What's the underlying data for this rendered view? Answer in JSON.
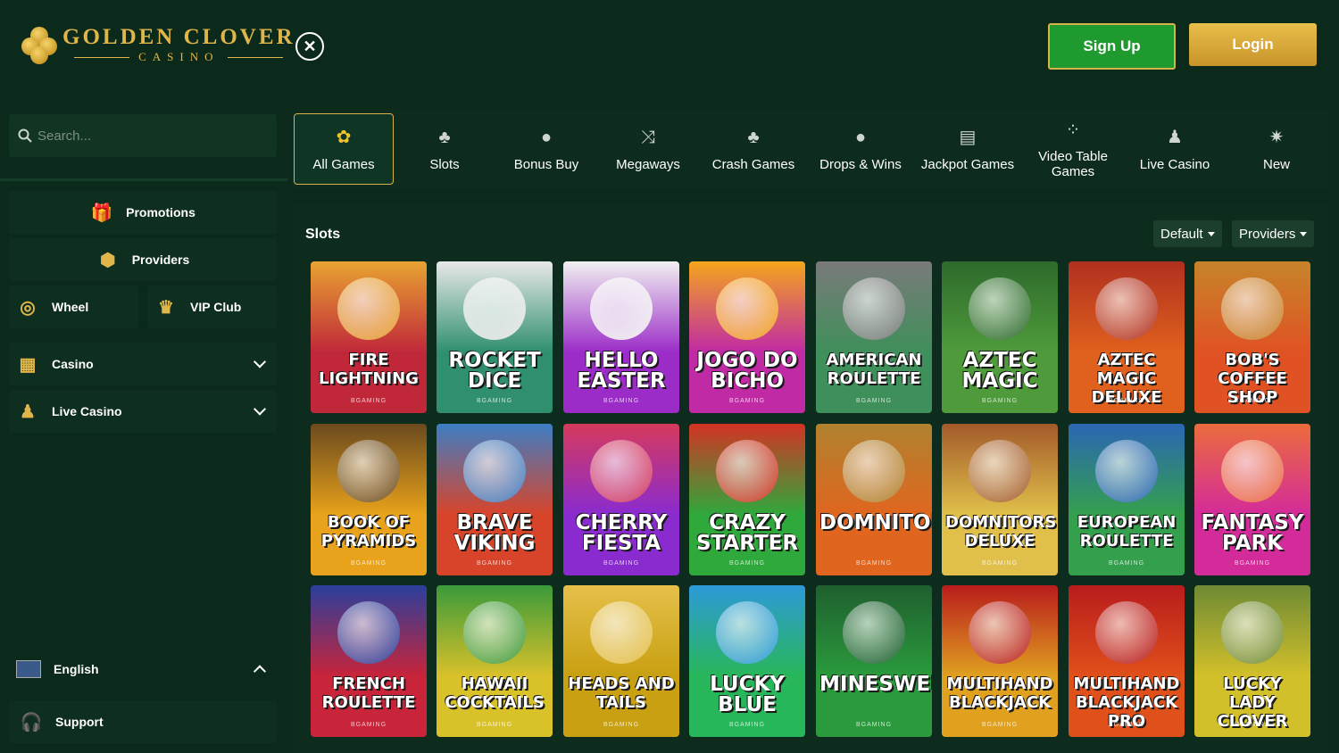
{
  "brand": {
    "name": "GOLDEN CLOVER",
    "sub": "CASINO"
  },
  "header": {
    "signup": "Sign Up",
    "login": "Login"
  },
  "sidebar": {
    "search_placeholder": "Search...",
    "promotions": "Promotions",
    "providers": "Providers",
    "wheel": "Wheel",
    "vip": "VIP Club",
    "casino": "Casino",
    "live_casino": "Live Casino",
    "language": "English",
    "support": "Support"
  },
  "tabs": [
    {
      "label": "All Games",
      "icon": "clover-icon"
    },
    {
      "label": "Slots",
      "icon": "cherries-icon"
    },
    {
      "label": "Bonus Buy",
      "icon": "money-bag-icon"
    },
    {
      "label": "Megaways",
      "icon": "shuffle-icon"
    },
    {
      "label": "Crash Games",
      "icon": "cherries-icon"
    },
    {
      "label": "Drops & Wins",
      "icon": "money-bag-icon"
    },
    {
      "label": "Jackpot Games",
      "icon": "slot-machine-icon"
    },
    {
      "label": "Video Table Games",
      "icon": "dice-icon"
    },
    {
      "label": "Live Casino",
      "icon": "dealer-icon"
    },
    {
      "label": "New",
      "icon": "sparkle-icon"
    }
  ],
  "section": {
    "title": "Slots",
    "sort": "Default",
    "filter": "Providers"
  },
  "provider_label": "BGAMING",
  "games": [
    {
      "title": "FIRE LIGHTNING",
      "bg": "#c0283a",
      "accent": "#e8a331"
    },
    {
      "title": "ROCKET DICE",
      "bg": "#2f8f6e",
      "accent": "#e8e8e8"
    },
    {
      "title": "HELLO EASTER",
      "bg": "#9b2cc8",
      "accent": "#f1f1f1"
    },
    {
      "title": "JOGO DO BICHO",
      "bg": "#c02aa4",
      "accent": "#f4a51c"
    },
    {
      "title": "AMERICAN ROULETTE",
      "bg": "#3f8f5a",
      "accent": "#7a7a7a"
    },
    {
      "title": "AZTEC MAGIC",
      "bg": "#4f9b3b",
      "accent": "#2d6a2c"
    },
    {
      "title": "AZTEC MAGIC DELUXE",
      "bg": "#e0601d",
      "accent": "#b03020"
    },
    {
      "title": "BOB'S COFFEE SHOP",
      "bg": "#e05223",
      "accent": "#c7842a"
    },
    {
      "title": "BOOK OF PYRAMIDS",
      "bg": "#e8a21b",
      "accent": "#6b4a1e"
    },
    {
      "title": "BRAVE VIKING",
      "bg": "#d8442a",
      "accent": "#3d7ec4"
    },
    {
      "title": "CHERRY FIESTA",
      "bg": "#8a2bd0",
      "accent": "#d63a5c"
    },
    {
      "title": "CRAZY STARTER",
      "bg": "#2fa83c",
      "accent": "#d33323"
    },
    {
      "title": "DOMNITORS",
      "bg": "#e0661f",
      "accent": "#b0822f"
    },
    {
      "title": "DOMNITORS DELUXE",
      "bg": "#e0c04a",
      "accent": "#a35a2a"
    },
    {
      "title": "EUROPEAN ROULETTE",
      "bg": "#34a04d",
      "accent": "#2b66b4"
    },
    {
      "title": "FANTASY PARK",
      "bg": "#d42b9a",
      "accent": "#eb6c3c"
    },
    {
      "title": "FRENCH ROULETTE",
      "bg": "#c8243a",
      "accent": "#2a3f9c"
    },
    {
      "title": "HAWAII COCKTAILS",
      "bg": "#d9c12a",
      "accent": "#3a9a3a"
    },
    {
      "title": "HEADS AND TAILS",
      "bg": "#c8a012",
      "accent": "#e5c04a"
    },
    {
      "title": "LUCKY BLUE",
      "bg": "#28b65a",
      "accent": "#2d9ad8"
    },
    {
      "title": "MINESWEEPER",
      "bg": "#2a9a3c",
      "accent": "#1f5f2f"
    },
    {
      "title": "MULTIHAND BLACKJACK",
      "bg": "#e0a020",
      "accent": "#b81c1c"
    },
    {
      "title": "MULTIHAND BLACKJACK PRO",
      "bg": "#e0501a",
      "accent": "#b81c1c"
    },
    {
      "title": "LUCKY LADY CLOVER",
      "bg": "#d2c02a",
      "accent": "#6e8a34"
    }
  ]
}
